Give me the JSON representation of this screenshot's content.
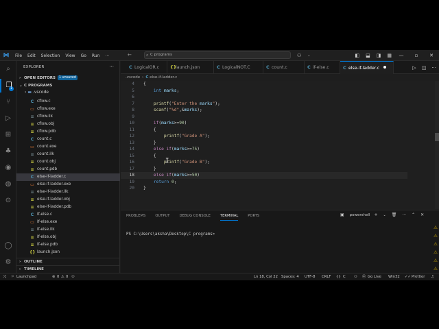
{
  "menu": [
    "File",
    "Edit",
    "Selection",
    "View",
    "Go",
    "Run"
  ],
  "menu_more": "···",
  "nav": {
    "back": "←",
    "forward": "→"
  },
  "search": {
    "text": "C programs"
  },
  "sidebar": {
    "title": "EXPLORER",
    "open_editors": {
      "label": "OPEN EDITORS",
      "badge": "1 unsaved"
    },
    "folder": {
      "label": "C PROGRAMS"
    },
    "subfolder": ".vscode",
    "files": [
      {
        "name": "cflow.c",
        "type": "c"
      },
      {
        "name": "cflow.exe",
        "type": "exe"
      },
      {
        "name": "cflow.ilk",
        "type": "ilk"
      },
      {
        "name": "cflow.obj",
        "type": "obj"
      },
      {
        "name": "cflow.pdb",
        "type": "pdb"
      },
      {
        "name": "count.c",
        "type": "c"
      },
      {
        "name": "count.exe",
        "type": "exe"
      },
      {
        "name": "count.ilk",
        "type": "ilk"
      },
      {
        "name": "count.obj",
        "type": "obj"
      },
      {
        "name": "count.pdb",
        "type": "pdb"
      },
      {
        "name": "else-if-ladder.c",
        "type": "c",
        "active": true
      },
      {
        "name": "else-if-ladder.exe",
        "type": "exe"
      },
      {
        "name": "else-if-ladder.ilk",
        "type": "ilk"
      },
      {
        "name": "else-if-ladder.obj",
        "type": "obj"
      },
      {
        "name": "else-if-ladder.pdb",
        "type": "pdb"
      },
      {
        "name": "if-else.c",
        "type": "c"
      },
      {
        "name": "if-else.exe",
        "type": "exe"
      },
      {
        "name": "if-else.ilk",
        "type": "ilk"
      },
      {
        "name": "if-else.obj",
        "type": "obj"
      },
      {
        "name": "if-else.pdb",
        "type": "pdb"
      },
      {
        "name": "launch.json",
        "type": "json"
      }
    ],
    "outline": "OUTLINE",
    "timeline": "TIMELINE"
  },
  "tabs": [
    {
      "label": "LogicalOR.c",
      "type": "c"
    },
    {
      "label": "launch.json",
      "type": "json"
    },
    {
      "label": "LogicalNOT.C",
      "type": "c"
    },
    {
      "label": "count.c",
      "type": "c"
    },
    {
      "label": "if-else.c",
      "type": "c"
    },
    {
      "label": "else-if-ladder.c",
      "type": "c",
      "active": true
    }
  ],
  "breadcrumb": [
    ".vscode",
    "else-if-ladder.c"
  ],
  "code_lines": [
    {
      "n": "4",
      "t": "{"
    },
    {
      "n": "5",
      "t": "    int marks;"
    },
    {
      "n": "6",
      "t": ""
    },
    {
      "n": "7",
      "t": "    printf(\"Enter the marks\");"
    },
    {
      "n": "8",
      "t": "    scanf(\"%d\",&marks);"
    },
    {
      "n": "9",
      "t": ""
    },
    {
      "n": "10",
      "t": "    if(marks>=90)"
    },
    {
      "n": "11",
      "t": "    {"
    },
    {
      "n": "12",
      "t": "        printf(\"Grade A\");"
    },
    {
      "n": "13",
      "t": "    }"
    },
    {
      "n": "14",
      "t": "    else if(marks>=75)"
    },
    {
      "n": "15",
      "t": "    {"
    },
    {
      "n": "16",
      "t": "        printf(\"Grade B\");"
    },
    {
      "n": "17",
      "t": "    }"
    },
    {
      "n": "18",
      "t": "    else if(marks>=50)",
      "current": true
    },
    {
      "n": "19",
      "t": "    return 0;"
    },
    {
      "n": "20",
      "t": "}"
    }
  ],
  "panel": {
    "tabs": [
      "PROBLEMS",
      "OUTPUT",
      "DEBUG CONSOLE",
      "TERMINAL",
      "PORTS"
    ],
    "active_tab": "TERMINAL",
    "terminal_name": "powershell",
    "prompt": "PS C:\\Users\\aksha\\Desktop\\C programs>"
  },
  "status": {
    "launchpad": "Launchpad",
    "errors": "0",
    "warnings": "0",
    "position": "Ln 18, Col 22",
    "spaces": "Spaces: 4",
    "encoding": "UTF-8",
    "eol": "CRLF",
    "language": "C",
    "golive": "Go Live",
    "platform": "Win32",
    "prettier": "Prettier"
  },
  "colors": {
    "accent": "#0078d4",
    "c_icon": "#519aba",
    "json_icon": "#cbcb41",
    "exe_icon": "#e37933",
    "warning": "#cca700"
  }
}
